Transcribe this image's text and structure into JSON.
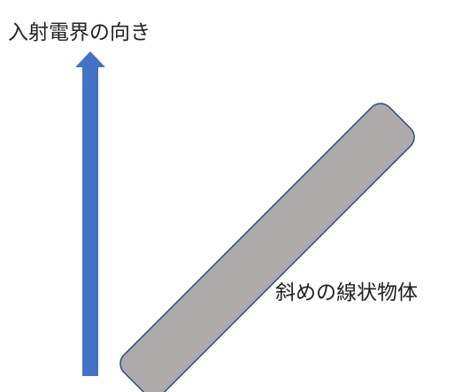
{
  "labels": {
    "incident_field_direction": "入射電界の向き",
    "oblique_linear_object": "斜めの線状物体"
  },
  "colors": {
    "arrow_fill": "#4472C4",
    "rod_fill": "#AEAAAA",
    "rod_stroke": "#2F4B86"
  }
}
